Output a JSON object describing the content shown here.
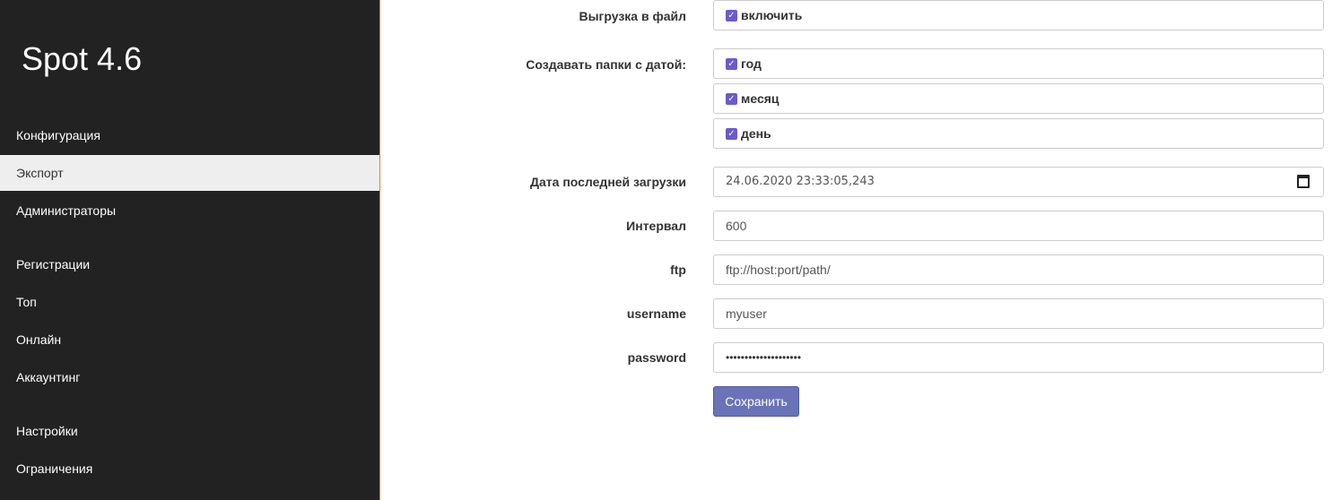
{
  "sidebar": {
    "brand": "Spot 4.6",
    "items": [
      {
        "label": "Конфигурация",
        "active": false
      },
      {
        "label": "Экспорт",
        "active": true
      },
      {
        "label": "Администраторы",
        "active": false
      },
      {
        "label": "Регистрации",
        "active": false
      },
      {
        "label": "Топ",
        "active": false
      },
      {
        "label": "Онлайн",
        "active": false
      },
      {
        "label": "Аккаунтинг",
        "active": false
      },
      {
        "label": "Настройки",
        "active": false
      },
      {
        "label": "Ограничения",
        "active": false
      }
    ]
  },
  "form": {
    "export_file": {
      "label": "Выгрузка в файл",
      "checkbox_label": "включить",
      "checked": true
    },
    "date_folders": {
      "label": "Создавать папки с датой:",
      "options": [
        {
          "label": "год",
          "checked": true
        },
        {
          "label": "месяц",
          "checked": true
        },
        {
          "label": "день",
          "checked": true
        }
      ]
    },
    "last_load": {
      "label": "Дата последней загрузки",
      "value": "24.06.2020 23:33:05,243"
    },
    "interval": {
      "label": "Интервал",
      "value": "600"
    },
    "ftp": {
      "label": "ftp",
      "placeholder": "ftp://host:port/path/"
    },
    "username": {
      "label": "username",
      "value": "myuser"
    },
    "password": {
      "label": "password",
      "value": "••••••••••••••••••••"
    },
    "save_label": "Сохранить"
  },
  "colors": {
    "sidebar_bg": "#222222",
    "accent": "#6a73b8",
    "checkbox": "#6a5acd"
  }
}
